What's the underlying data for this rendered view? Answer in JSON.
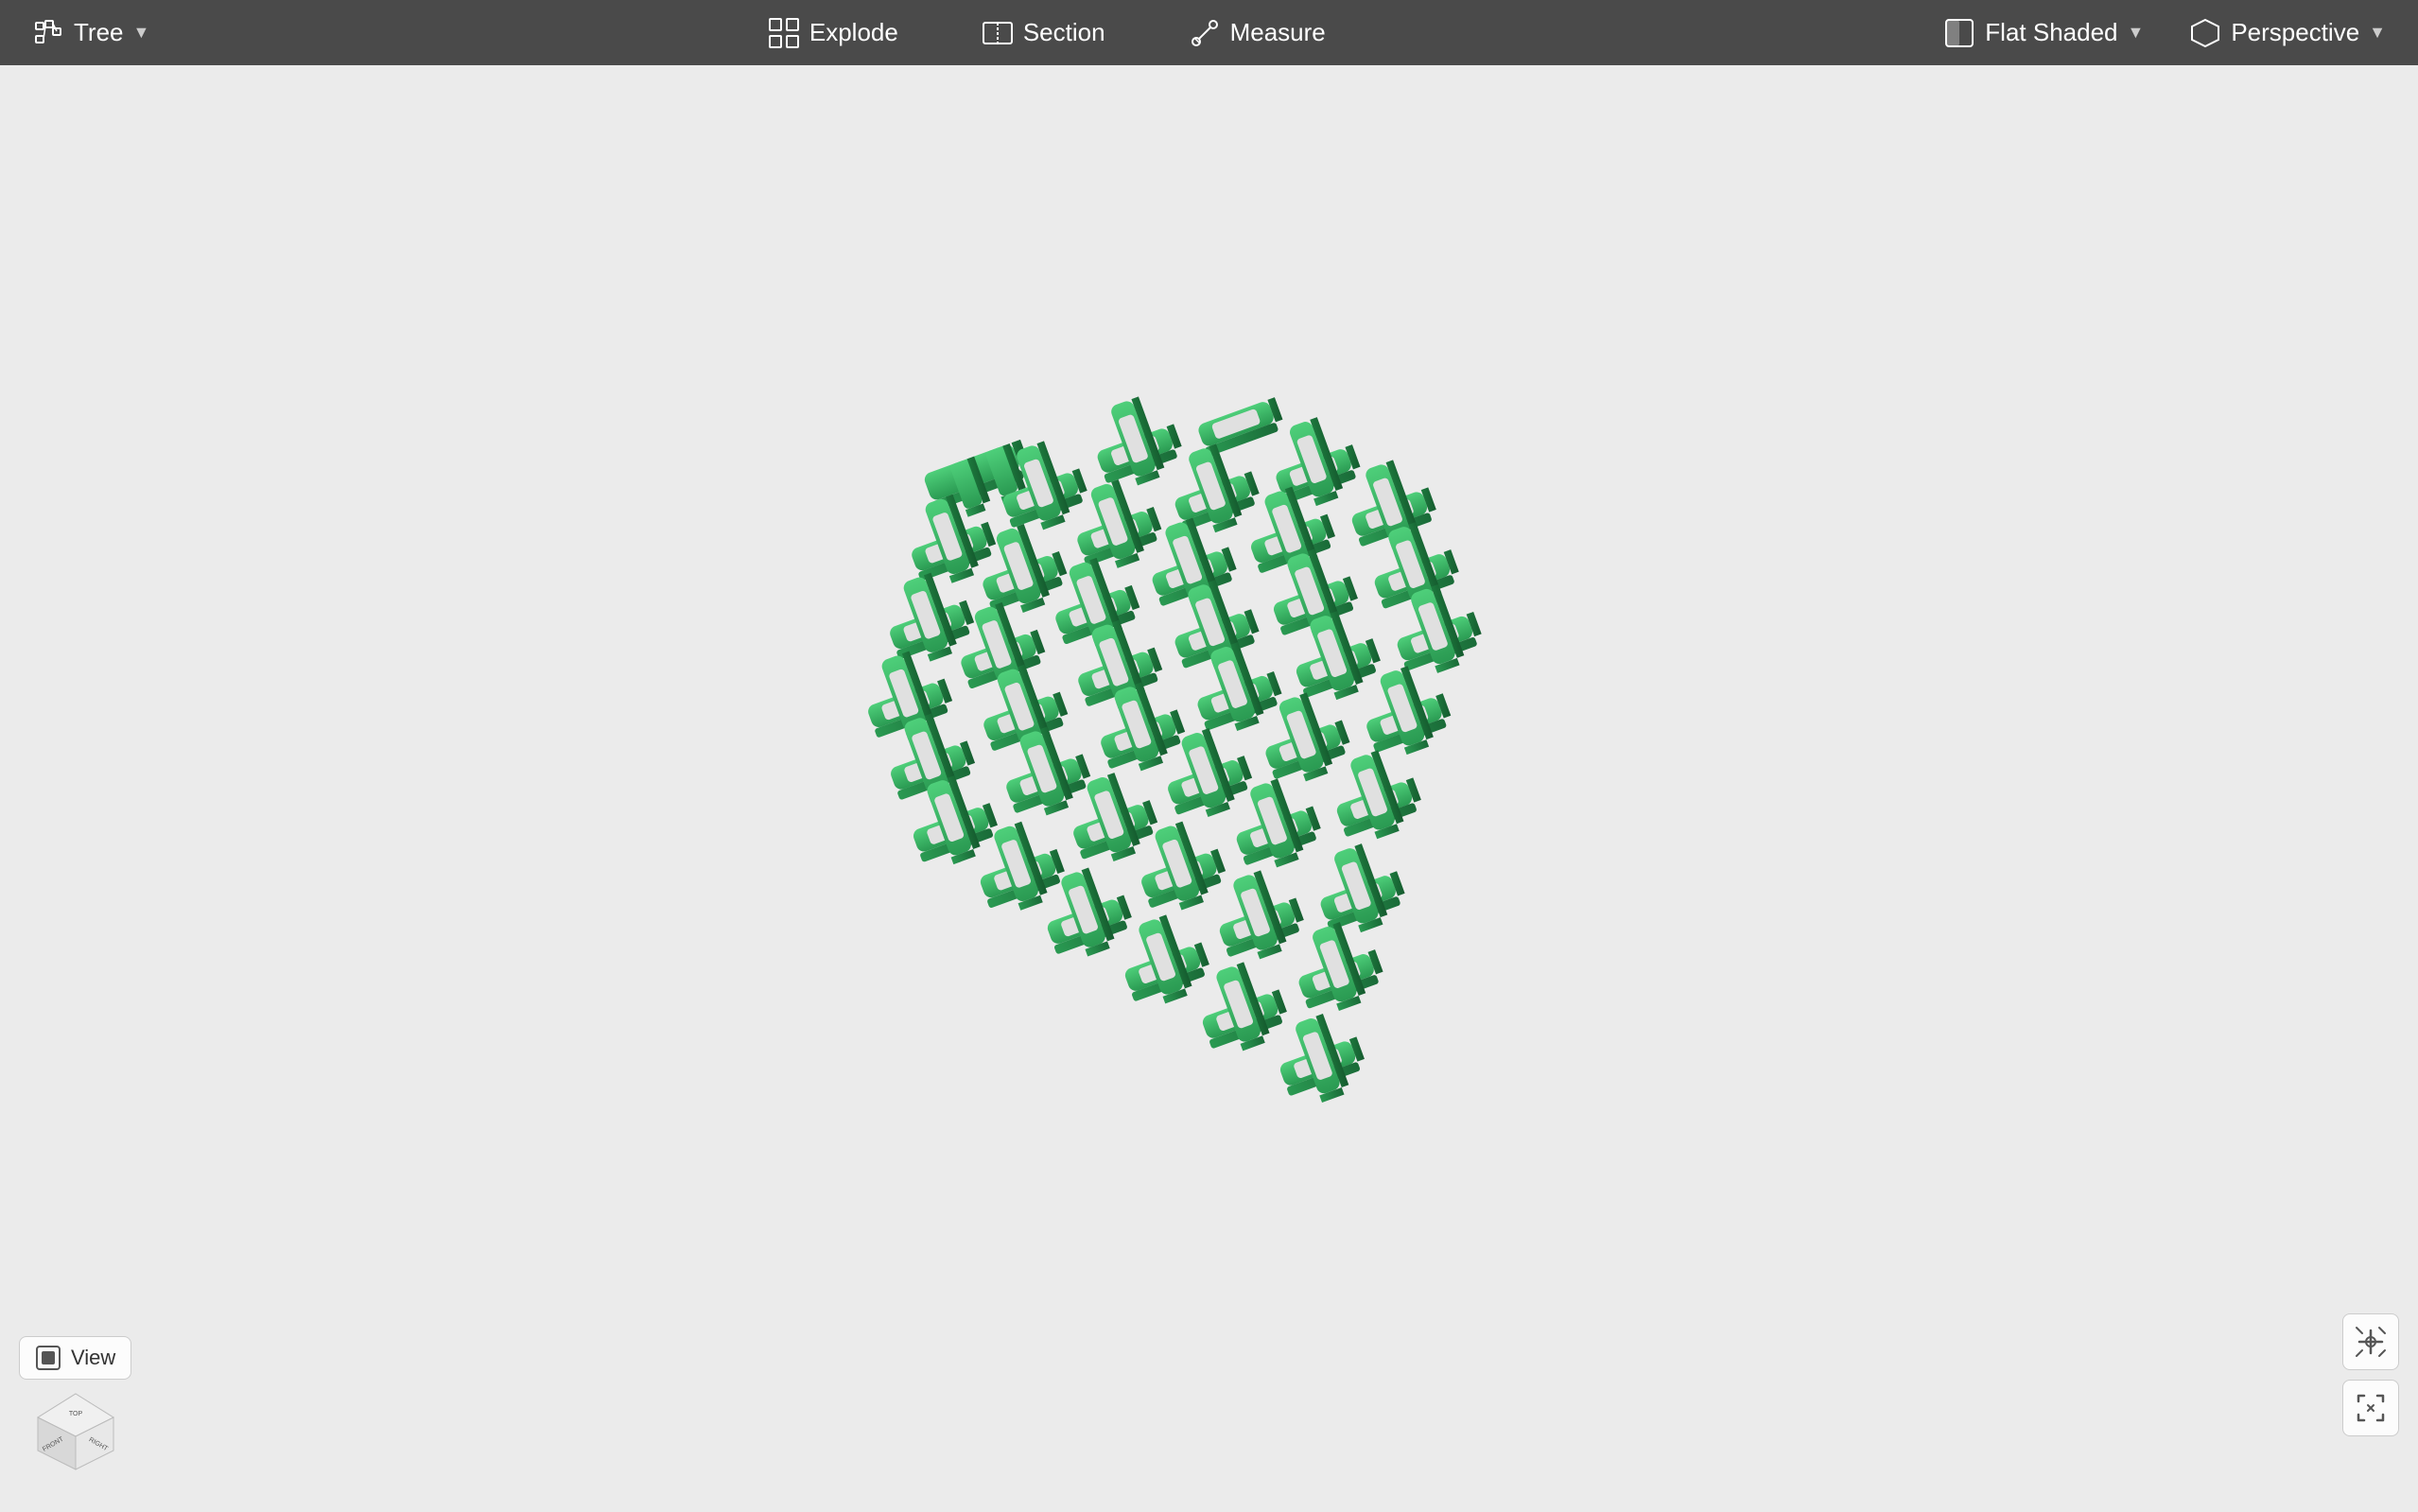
{
  "toolbar": {
    "tree_label": "Tree",
    "explode_label": "Explode",
    "section_label": "Section",
    "measure_label": "Measure",
    "flat_shaded_label": "Flat Shaded",
    "perspective_label": "Perspective",
    "dropdown_arrow": "▼"
  },
  "viewport": {
    "background_color": "#ebebeb"
  },
  "view_controls": {
    "view_btn_label": "View",
    "fit_icon": "⤢",
    "snap_icon": "✛"
  },
  "icons": {
    "tree": "⋮⋮",
    "explode": "⊞",
    "section": "▭",
    "measure": "📐",
    "flat_shaded": "◫",
    "perspective": "◻",
    "view": "◻"
  }
}
